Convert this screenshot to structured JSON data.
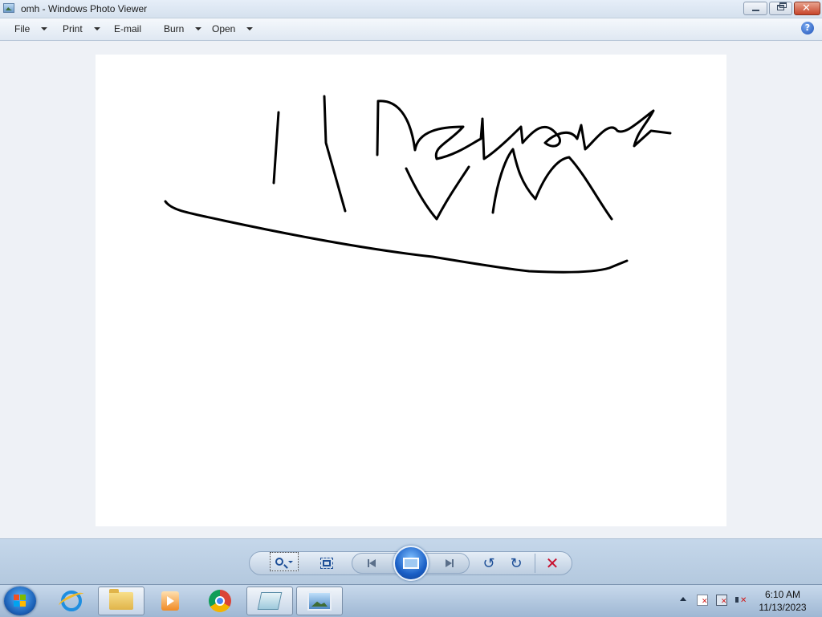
{
  "window": {
    "title": "omh - Windows Photo Viewer",
    "controls": {
      "minimize": "minimize",
      "maximize": "restore",
      "close": "close"
    }
  },
  "menu": {
    "items": [
      {
        "label": "File",
        "dropdown": true
      },
      {
        "label": "Print",
        "dropdown": true
      },
      {
        "label": "E-mail",
        "dropdown": false
      },
      {
        "label": "Burn",
        "dropdown": true
      },
      {
        "label": "Open",
        "dropdown": true
      }
    ],
    "help_icon": "?"
  },
  "photo": {
    "filename": "omh",
    "handwritten_text": [
      "| |",
      "Network",
      "VM"
    ]
  },
  "controls": {
    "zoom": "zoom-icon",
    "actual_size": "fit-window-icon",
    "previous": "previous-icon",
    "slideshow": "slideshow-icon",
    "next": "next-icon",
    "rotate_ccw": "↺",
    "rotate_cw": "↻",
    "delete": "✕"
  },
  "taskbar": {
    "pinned": [
      "internet-explorer",
      "windows-explorer",
      "windows-media-player",
      "google-chrome",
      "notepad",
      "windows-photo-viewer"
    ],
    "active": "windows-photo-viewer",
    "clock": {
      "time": "6:10 AM",
      "date": "11/13/2023"
    }
  },
  "colors": {
    "accent": "#1a5fc6",
    "close_button": "#c7452b",
    "delete": "#c8102e"
  }
}
